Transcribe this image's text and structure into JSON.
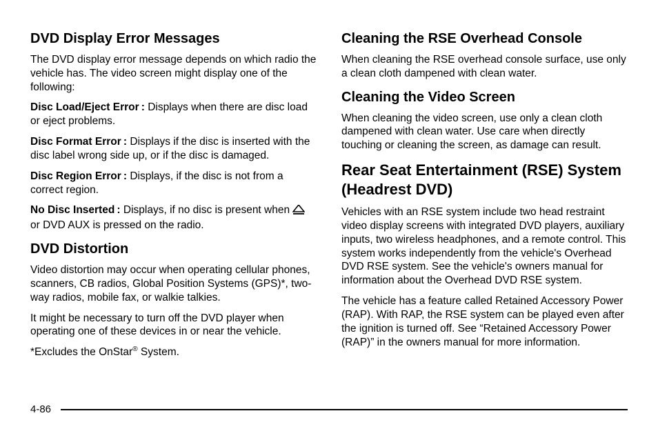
{
  "left": {
    "h_error": "DVD Display Error Messages",
    "error_intro": "The DVD display error message depends on which radio the vehicle has. The video screen might display one of the following:",
    "err1_label": "Disc Load/Eject Error :",
    "err1_body": " Displays when there are disc load or eject problems.",
    "err2_label": "Disc Format Error :",
    "err2_body": " Displays if the disc is inserted with the disc label wrong side up, or if the disc is damaged.",
    "err3_label": "Disc Region Error :",
    "err3_body": " Displays, if the disc is not from a correct region.",
    "err4_label": "No Disc Inserted :",
    "err4_body_a": " Displays, if no disc is present when ",
    "err4_body_b": " or DVD AUX is pressed on the radio.",
    "h_dist": "DVD Distortion",
    "dist_p1": "Video distortion may occur when operating cellular phones, scanners, CB radios, Global Position Systems (GPS)*, two-way radios, mobile fax, or walkie talkies.",
    "dist_p2": "It might be necessary to turn off the DVD player when operating one of these devices in or near the vehicle.",
    "dist_note_a": "*Excludes the OnStar",
    "dist_note_sup": "®",
    "dist_note_b": " System."
  },
  "right": {
    "h_clean_console": "Cleaning the RSE Overhead Console",
    "clean_console_p": "When cleaning the RSE overhead console surface, use only a clean cloth dampened with clean water.",
    "h_clean_screen": "Cleaning the Video Screen",
    "clean_screen_p": "When cleaning the video screen, use only a clean cloth dampened with clean water. Use care when directly touching or cleaning the screen, as damage can result.",
    "h_rse": "Rear Seat Entertainment (RSE) System (Headrest DVD)",
    "rse_p1": "Vehicles with an RSE system include two head restraint video display screens with integrated DVD players, auxiliary inputs, two wireless headphones, and a remote control. This system works independently from the vehicle's Overhead DVD RSE system. See the vehicle's owners manual for information about the Overhead DVD RSE system.",
    "rse_p2": "The vehicle has a feature called Retained Accessory Power (RAP). With RAP, the RSE system can be played even after the ignition is turned off. See “Retained Accessory Power (RAP)” in the owners manual for more information."
  },
  "page_number": "4-86"
}
